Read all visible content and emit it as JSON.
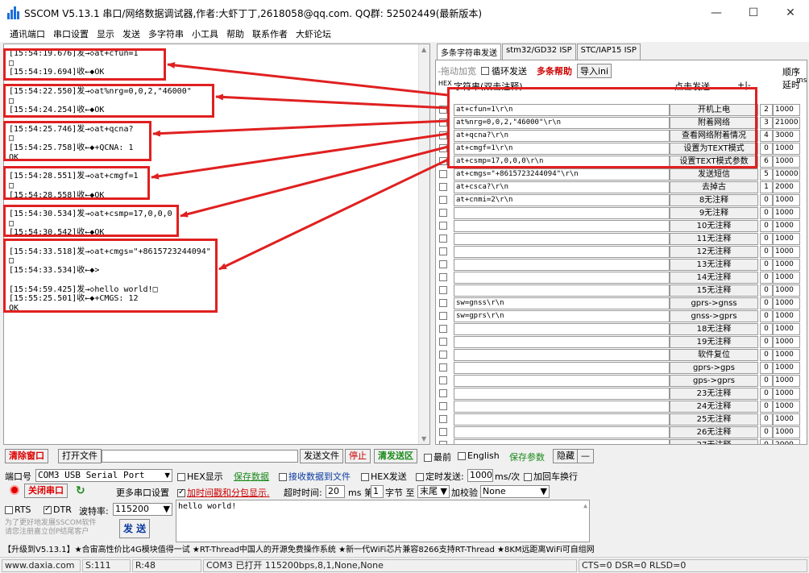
{
  "window": {
    "title": "SSCOM V5.13.1 串口/网络数据调试器,作者:大虾丁丁,2618058@qq.com. QQ群: 52502449(最新版本)",
    "minimize": "—",
    "maximize": "☐",
    "close": "✕"
  },
  "menu": [
    "通讯端口",
    "串口设置",
    "显示",
    "发送",
    "多字符串",
    "小工具",
    "帮助",
    "联系作者",
    "大虾论坛"
  ],
  "receive_log": [
    "[15:54:19.676]发→◇at+cfun=1",
    "□",
    "[15:54:19.694]收←◆OK",
    "",
    "[15:54:22.550]发→◇at%nrg=0,0,2,\"46000\"",
    "□",
    "[15:54:24.254]收←◆OK",
    "",
    "[15:54:25.746]发→◇at+qcna?",
    "□",
    "[15:54:25.758]收←◆+QCNA: 1",
    "OK",
    "",
    "[15:54:28.551]发→◇at+cmgf=1",
    "□",
    "[15:54:28.558]收←◆OK",
    "",
    "[15:54:30.534]发→◇at+csmp=17,0,0,0",
    "□",
    "[15:54:30.542]收←◆OK",
    "",
    "[15:54:33.518]发→◇at+cmgs=\"+8615723244094\"",
    "□",
    "[15:54:33.534]收←◆>",
    "",
    "[15:54:59.425]发→◇hello world!□",
    "[15:55:25.501]收←◆+CMGS: 12",
    "OK"
  ],
  "tabs": [
    "多条字符串发送",
    "stm32/GD32 ISP",
    "STC/IAP15 ISP"
  ],
  "multi_toolbar": {
    "drag": "-拖动加宽",
    "loop": "循环发送",
    "help": "多条帮助",
    "import": "导入ini",
    "order": "顺序",
    "delay": "延时",
    "ms": "ms",
    "hex_header": "HEX",
    "string_header": "字符串(双击注释)",
    "click_header": "点击发送",
    "plusminus": "+|-"
  },
  "rows": [
    {
      "s": "at+cfun=1\\r\\n",
      "b": "开机上电",
      "o": "2",
      "d": "1000"
    },
    {
      "s": "at%nrg=0,0,2,\"46000\"\\r\\n",
      "b": "附着网络",
      "o": "3",
      "d": "21000"
    },
    {
      "s": "at+qcna?\\r\\n",
      "b": "查看网络附着情况",
      "o": "4",
      "d": "3000"
    },
    {
      "s": "at+cmgf=1\\r\\n",
      "b": "设置为TEXT模式",
      "o": "0",
      "d": "1000"
    },
    {
      "s": "at+csmp=17,0,0,0\\r\\n",
      "b": "设置TEXT模式参数",
      "o": "6",
      "d": "1000"
    },
    {
      "s": "at+cmgs=\"+8615723244094\"\\r\\n",
      "b": "发送短信",
      "o": "5",
      "d": "10000"
    },
    {
      "s": "at+csca?\\r\\n",
      "b": "去掉古",
      "o": "1",
      "d": "2000"
    },
    {
      "s": "at+cnmi=2\\r\\n",
      "b": "8无注释",
      "o": "0",
      "d": "1000"
    },
    {
      "s": "",
      "b": "9无注释",
      "o": "0",
      "d": "1000"
    },
    {
      "s": "",
      "b": "10无注释",
      "o": "0",
      "d": "1000"
    },
    {
      "s": "",
      "b": "11无注释",
      "o": "0",
      "d": "1000"
    },
    {
      "s": "",
      "b": "12无注释",
      "o": "0",
      "d": "1000"
    },
    {
      "s": "",
      "b": "13无注释",
      "o": "0",
      "d": "1000"
    },
    {
      "s": "",
      "b": "14无注释",
      "o": "0",
      "d": "1000"
    },
    {
      "s": "",
      "b": "15无注释",
      "o": "0",
      "d": "1000"
    },
    {
      "s": "sw=gnss\\r\\n",
      "b": "gprs->gnss",
      "o": "0",
      "d": "1000"
    },
    {
      "s": "sw=gprs\\r\\n",
      "b": "gnss->gprs",
      "o": "0",
      "d": "1000"
    },
    {
      "s": "",
      "b": "18无注释",
      "o": "0",
      "d": "1000"
    },
    {
      "s": "",
      "b": "19无注释",
      "o": "0",
      "d": "1000"
    },
    {
      "s": "",
      "b": "软件复位",
      "o": "0",
      "d": "1000"
    },
    {
      "s": "",
      "b": "gprs->gps",
      "o": "0",
      "d": "1000"
    },
    {
      "s": "",
      "b": "gps->gprs",
      "o": "0",
      "d": "1000"
    },
    {
      "s": "",
      "b": "23无注释",
      "o": "0",
      "d": "1000"
    },
    {
      "s": "",
      "b": "24无注释",
      "o": "0",
      "d": "1000"
    },
    {
      "s": "",
      "b": "25无注释",
      "o": "0",
      "d": "1000"
    },
    {
      "s": "",
      "b": "26无注释",
      "o": "0",
      "d": "1000"
    },
    {
      "s": "",
      "b": "27无注释",
      "o": "0",
      "d": "2000"
    }
  ],
  "bottom": {
    "clear_window": "清除窗口",
    "open_file": "打开文件",
    "send_file": "发送文件",
    "stop": "停止",
    "clear_send": "清发送区",
    "front": "最前",
    "english": "English",
    "save_params": "保存参数",
    "hide": "隐藏",
    "collapse": "—",
    "port_label": "端口号",
    "port_value": "COM3 USB Serial Port",
    "hex_display": "HEX显示",
    "save_data": "保存数据",
    "recv_to_file": "接收数据到文件",
    "hex_send": "HEX发送",
    "timed_send": "定时发送:",
    "timed_value": "1000",
    "per_times": "ms/次",
    "add_crlf": "加回车换行",
    "close_port": "关闭串口",
    "more_settings": "更多串口设置",
    "add_timestamp": "加时间戳和分包显示.",
    "timeout_label": "超时时间:",
    "timeout_value": "20",
    "ms_di": "ms 第",
    "byte_index": "1",
    "byte_to": "字节 至",
    "tail": "末尾",
    "checksum_label": "加校验",
    "checksum_value": "None",
    "rts": "RTS",
    "dtr": "DTR",
    "baud_label": "波特率:",
    "baud_value": "115200",
    "send_text": "hello world!",
    "promo": "为了更好地发展SSCOM软件\n请您注册嘉立创P结尾客户",
    "send_button": "发 送"
  },
  "ad": "【升级到V5.13.1】★合宙高性价比4G模块值得一试 ★RT-Thread中国人的开源免费操作系统 ★新一代WiFi芯片兼容8266支持RT-Thread ★8KM远距离WiFi可自组网",
  "status": {
    "site": "www.daxia.com",
    "sent": "S:111",
    "received": "R:48",
    "port": "COM3 已打开  115200bps,8,1,None,None",
    "lines": "CTS=0 DSR=0 RLSD=0"
  },
  "colors": {
    "annotation": "#e02020",
    "link_green": "#1a8a1a",
    "help_red": "#cc0000"
  }
}
